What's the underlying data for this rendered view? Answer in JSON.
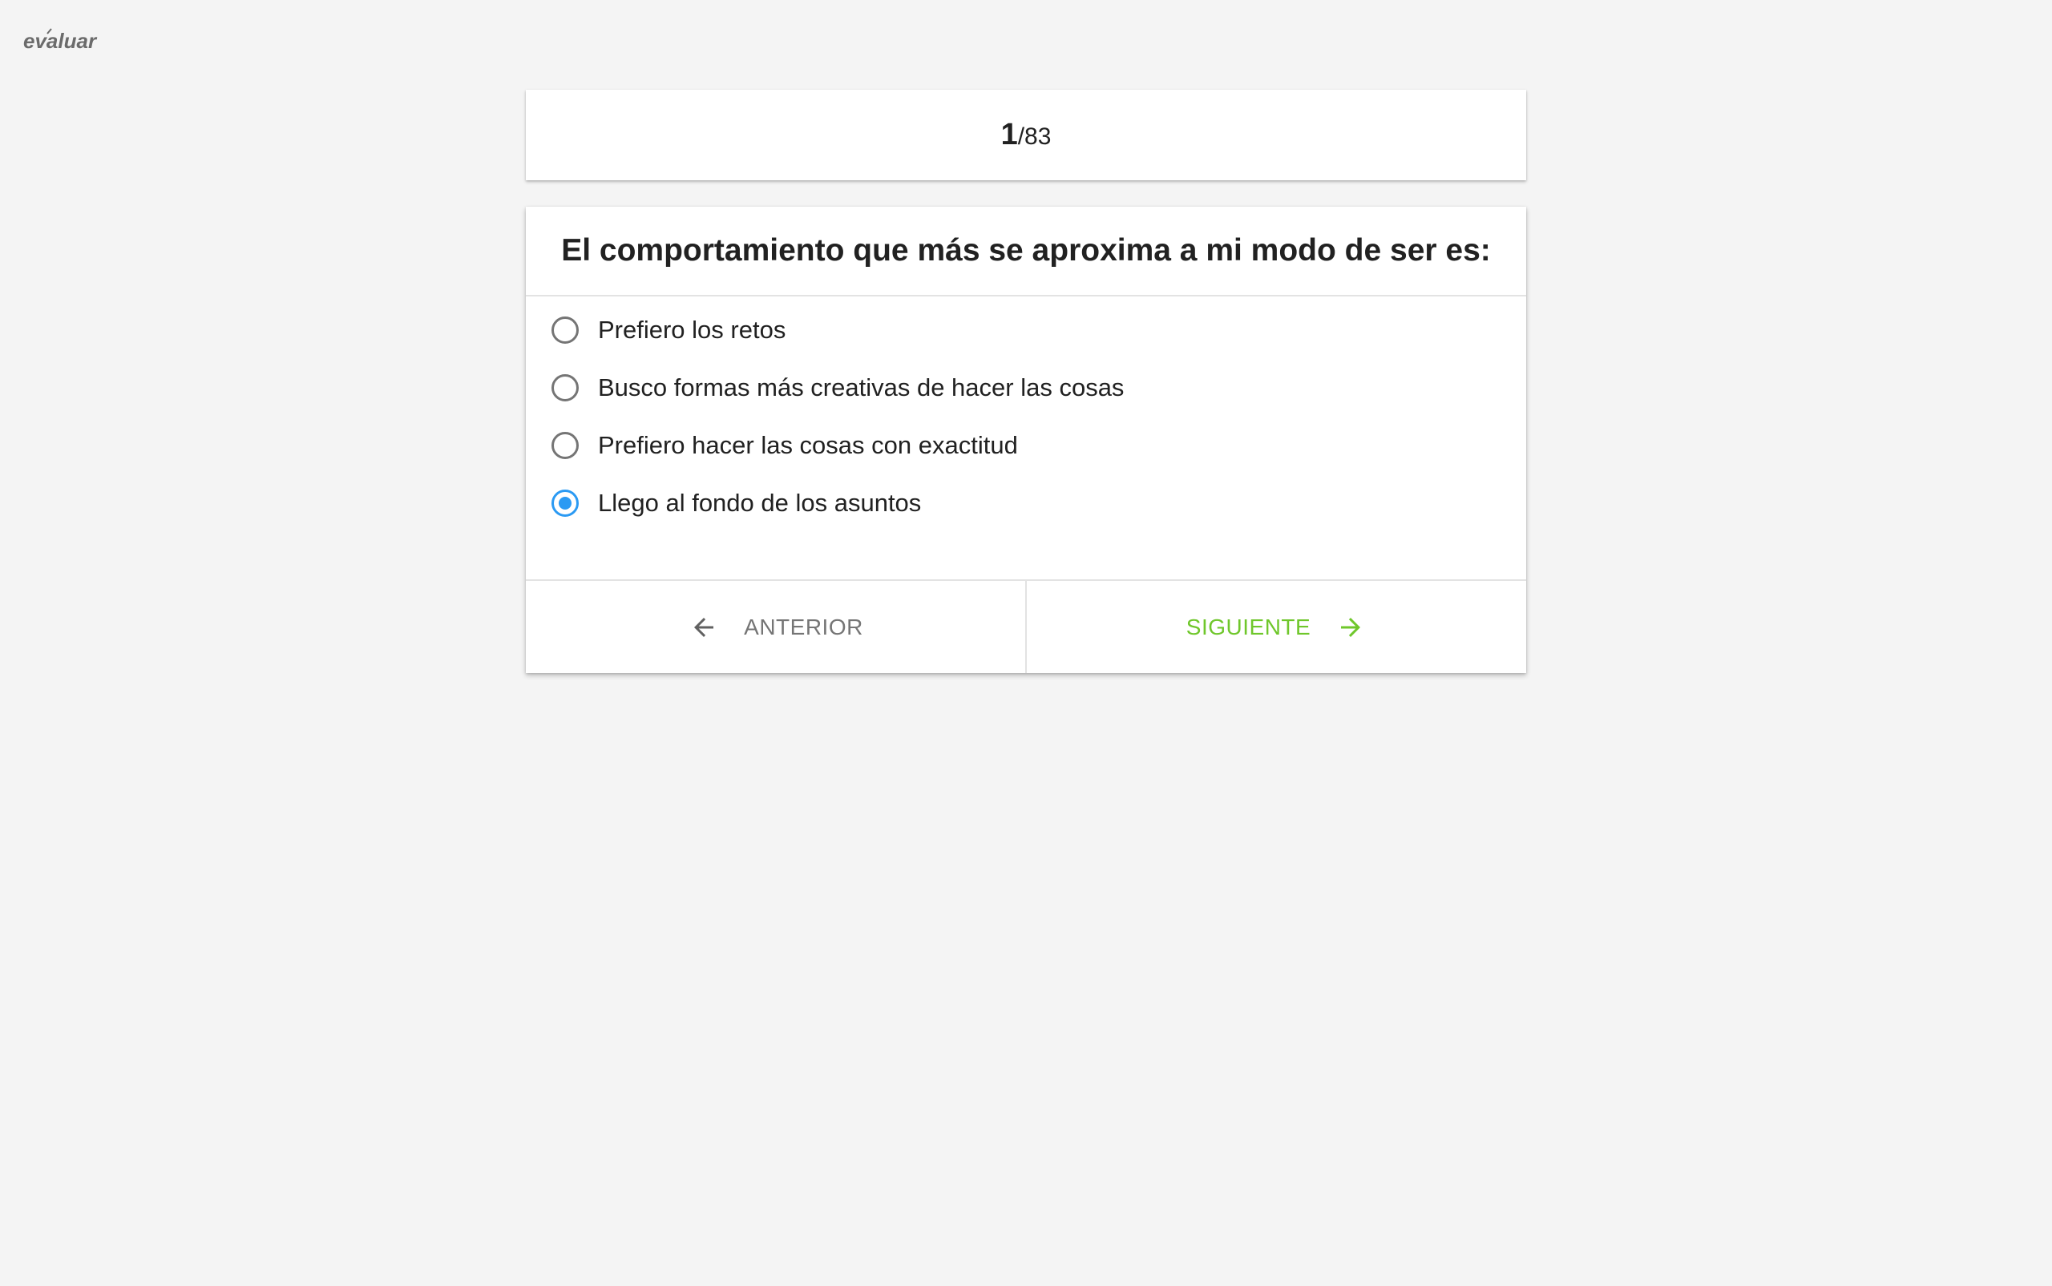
{
  "app": {
    "logo_text": "evaluar"
  },
  "progress": {
    "current": "1",
    "separator": "/",
    "total": "83"
  },
  "question": {
    "title": "El comportamiento que más se aproxima a mi modo de ser es:",
    "options": [
      {
        "label": "Prefiero los retos",
        "selected": false
      },
      {
        "label": "Busco formas más creativas de hacer las cosas",
        "selected": false
      },
      {
        "label": "Prefiero hacer las cosas con exactitud",
        "selected": false
      },
      {
        "label": "Llego al fondo de los asuntos",
        "selected": true
      }
    ]
  },
  "navigation": {
    "prev_label": "ANTERIOR",
    "next_label": "SIGUIENTE",
    "prev_icon": "arrow-left-icon",
    "next_icon": "arrow-right-icon"
  },
  "colors": {
    "background": "#f4f4f4",
    "accent_radio": "#2b9af3",
    "next_green": "#6fc72b",
    "prev_gray": "#757575"
  }
}
